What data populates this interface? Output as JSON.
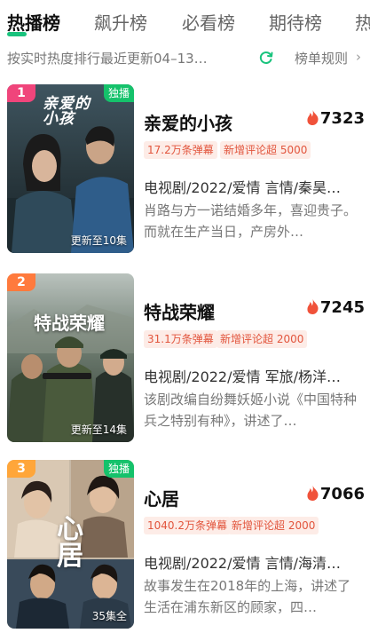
{
  "tabs": [
    {
      "label": "热播榜",
      "active": true
    },
    {
      "label": "飙升榜"
    },
    {
      "label": "必看榜"
    },
    {
      "label": "期待榜"
    },
    {
      "label": "热"
    }
  ],
  "subheader": {
    "sort_text": "按实时热度排行最近更新04–13…",
    "rules_label": "榜单规则",
    "chevron": "›"
  },
  "items": [
    {
      "rank": "1",
      "rank_color": "#f0457b",
      "exclusive": "独播",
      "poster_title": "亲爱的小孩",
      "update": "更新至10集",
      "title": "亲爱的小孩",
      "heat": "7323",
      "tags": [
        "17.2万条弹幕",
        "新增评论超 5000"
      ],
      "meta": "电视剧/2022/爱情 言情/秦昊…",
      "desc": "肖路与方一诺结婚多年，喜迎贵子。而就在生产当日，产房外…"
    },
    {
      "rank": "2",
      "rank_color": "#ff7a3d",
      "exclusive": "",
      "poster_title": "特战荣耀",
      "update": "更新至14集",
      "title": "特战荣耀",
      "heat": "7245",
      "tags": [
        "31.1万条弹幕",
        "新增评论超 2000"
      ],
      "meta": "电视剧/2022/爱情 军旅/杨洋…",
      "desc": "该剧改编自纷舞妖姬小说《中国特种兵之特别有种》，讲述了…"
    },
    {
      "rank": "3",
      "rank_color": "#ffa63a",
      "exclusive": "独播",
      "poster_title": "心居",
      "update": "35集全",
      "title": "心居",
      "heat": "7066",
      "tags": [
        "1040.2万条弹幕",
        "新增评论超 2000"
      ],
      "meta": "电视剧/2022/爱情 言情/海清…",
      "desc": "故事发生在2018年的上海，讲述了生活在浦东新区的顾家，四…"
    }
  ],
  "colors": {
    "accent": "#19c37d",
    "hot_flame": "#f0523a",
    "tag_text": "#e2553d",
    "tag_bg": "#fdece7"
  }
}
